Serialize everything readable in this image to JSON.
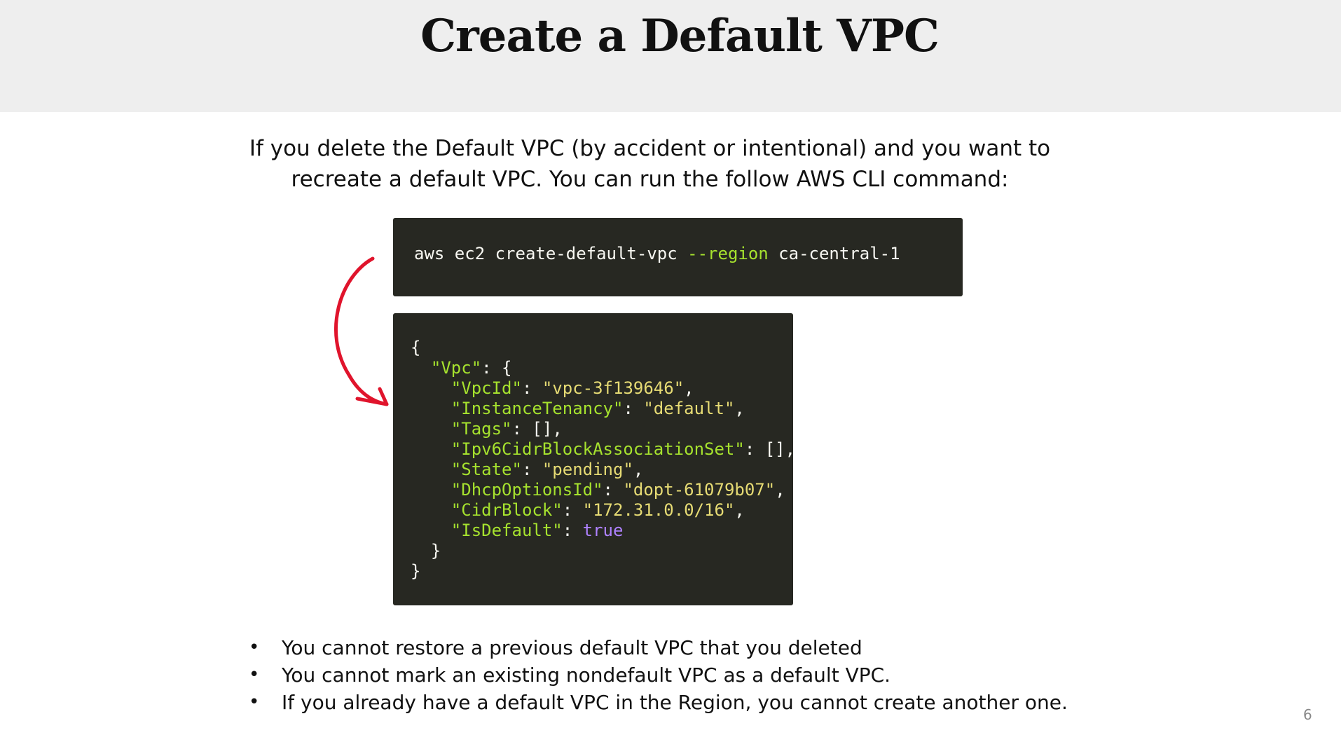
{
  "slide": {
    "title": "Create a Default VPC",
    "page_number": "6"
  },
  "intro": {
    "line1": "If you delete the Default VPC (by accident or intentional) and you want to",
    "line2": "recreate a default VPC. You can run the follow AWS CLI command:"
  },
  "command": {
    "base": "aws ec2 create-default-vpc ",
    "flag": "--region",
    "value": " ca-central-1"
  },
  "output": {
    "open_brace": "{",
    "vpc_key": "\"Vpc\"",
    "vpc_sep": ": {",
    "fields": [
      {
        "key": "\"VpcId\"",
        "sep": ": ",
        "value": "\"vpc-3f139646\"",
        "end": ","
      },
      {
        "key": "\"InstanceTenancy\"",
        "sep": ": ",
        "value": "\"default\"",
        "end": ","
      },
      {
        "key": "\"Tags\"",
        "sep": ": ",
        "value": "[]",
        "end": ","
      },
      {
        "key": "\"Ipv6CidrBlockAssociationSet\"",
        "sep": ": ",
        "value": "[]",
        "end": ","
      },
      {
        "key": "\"State\"",
        "sep": ": ",
        "value": "\"pending\"",
        "end": ","
      },
      {
        "key": "\"DhcpOptionsId\"",
        "sep": ": ",
        "value": "\"dopt-61079b07\"",
        "end": ","
      },
      {
        "key": "\"CidrBlock\"",
        "sep": ": ",
        "value": "\"172.31.0.0/16\"",
        "end": ","
      },
      {
        "key": "\"IsDefault\"",
        "sep": ": ",
        "value": "true",
        "end": ""
      }
    ],
    "inner_close": "}",
    "close_brace": "}"
  },
  "bullets": [
    "You cannot restore a previous default VPC that you deleted",
    "You cannot mark an existing nondefault VPC as a default VPC.",
    "If you already have a default VPC in the Region, you cannot create another one."
  ],
  "bullet_symbol": "•",
  "colors": {
    "code_bg": "#272822",
    "code_text": "#f8f8f2",
    "code_key": "#a6e22e",
    "code_string": "#e6db74",
    "code_keyword": "#ae81ff",
    "arrow": "#e0142c",
    "title_band": "#eeeeee"
  },
  "icons": {
    "arrow": "curved-arrow-icon"
  }
}
